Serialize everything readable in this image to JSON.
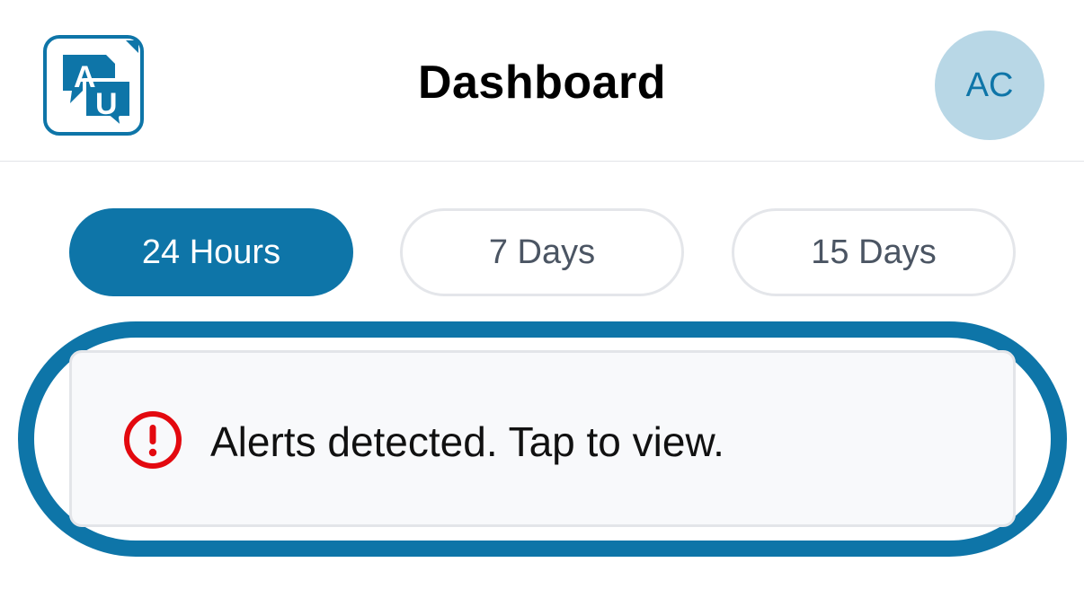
{
  "colors": {
    "accent": "#0e75a8",
    "avatar_bg": "#b8d7e6",
    "alert_red": "#e3090f"
  },
  "header": {
    "logo_icon": "au-chat-logo-icon",
    "logo_letters": {
      "first": "A",
      "second": "U"
    },
    "title": "Dashboard",
    "avatar_initials": "AC"
  },
  "range_tabs": [
    {
      "label": "24 Hours",
      "selected": true
    },
    {
      "label": "7 Days",
      "selected": false
    },
    {
      "label": "15 Days",
      "selected": false
    }
  ],
  "alert": {
    "icon": "exclamation-circle-icon",
    "message": "Alerts detected. Tap to view."
  }
}
